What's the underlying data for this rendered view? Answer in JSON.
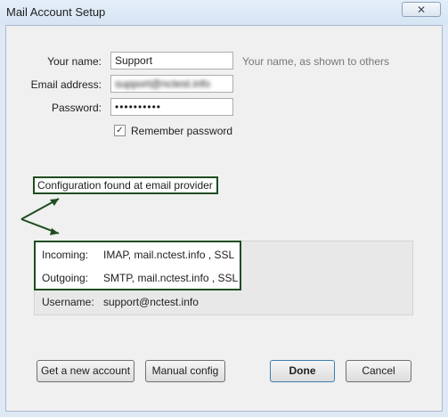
{
  "window": {
    "title": "Mail Account Setup",
    "close_glyph": "✕"
  },
  "form": {
    "name_label": "Your name:",
    "name_value": "Support",
    "name_hint": "Your name, as shown to others",
    "email_label": "Email address:",
    "email_value": "support@nctest.info",
    "password_label": "Password:",
    "password_value": "••••••••••",
    "remember_label": "Remember password",
    "remember_checked": true,
    "check_glyph": "✓"
  },
  "status": {
    "config_found": "Configuration found at email provider"
  },
  "server": {
    "incoming_label": "Incoming:",
    "incoming_value": "IMAP, mail.nctest.info , SSL",
    "outgoing_label": "Outgoing:",
    "outgoing_value": "SMTP, mail.nctest.info , SSL",
    "username_label": "Username:",
    "username_value": "support@nctest.info"
  },
  "buttons": {
    "new_account": "Get a new account",
    "manual_config": "Manual config",
    "done": "Done",
    "cancel": "Cancel"
  },
  "colors": {
    "annotation": "#1f4d1f",
    "background": "#dfe9f5"
  }
}
